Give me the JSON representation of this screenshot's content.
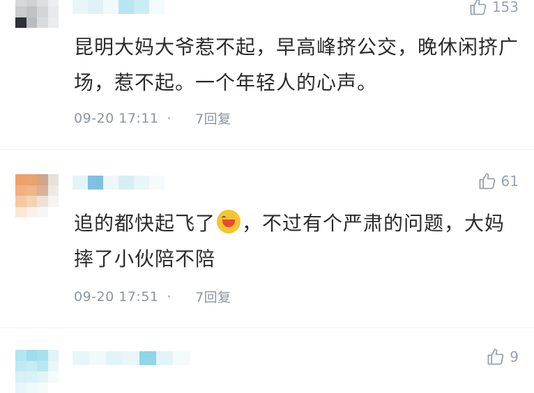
{
  "comments": [
    {
      "likes": "153",
      "text": "昆明大妈大爷惹不起，早高峰挤公交，晚休闲挤广场，惹不起。一个年轻人的心声。",
      "date": "09-20 17:11",
      "dot": "·",
      "replies": "7回复"
    },
    {
      "likes": "61",
      "text_before_emoji": "追的都快起飞了",
      "emoji": "laughing-face-emoji",
      "text_after_emoji": "，不过有个严肃的问题，大妈摔了小伙陪不陪",
      "date": "09-20 17:51",
      "dot": "·",
      "replies": "7回复"
    },
    {
      "likes": "9"
    }
  ],
  "colors": {
    "text": "#2b2b2b",
    "meta": "#8d959e",
    "avatar_blur_blue": "#a9e3ef",
    "avatar_blur_orange": "#f0a36c"
  }
}
